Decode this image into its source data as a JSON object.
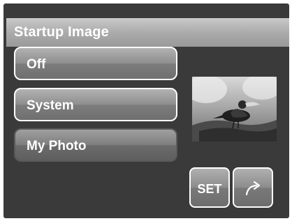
{
  "menu": {
    "title": "Startup Image",
    "options": [
      {
        "label": "Off",
        "selected": false
      },
      {
        "label": "System",
        "selected": false
      },
      {
        "label": "My Photo",
        "selected": true
      }
    ]
  },
  "preview": {
    "icon": "bird-photo-thumbnail"
  },
  "footer": {
    "set_label": "SET",
    "return_icon": "return-arrow-icon"
  },
  "colors": {
    "background": "#3a3a3a",
    "title_bar": "#b3b3b3",
    "text": "#ffffff"
  }
}
